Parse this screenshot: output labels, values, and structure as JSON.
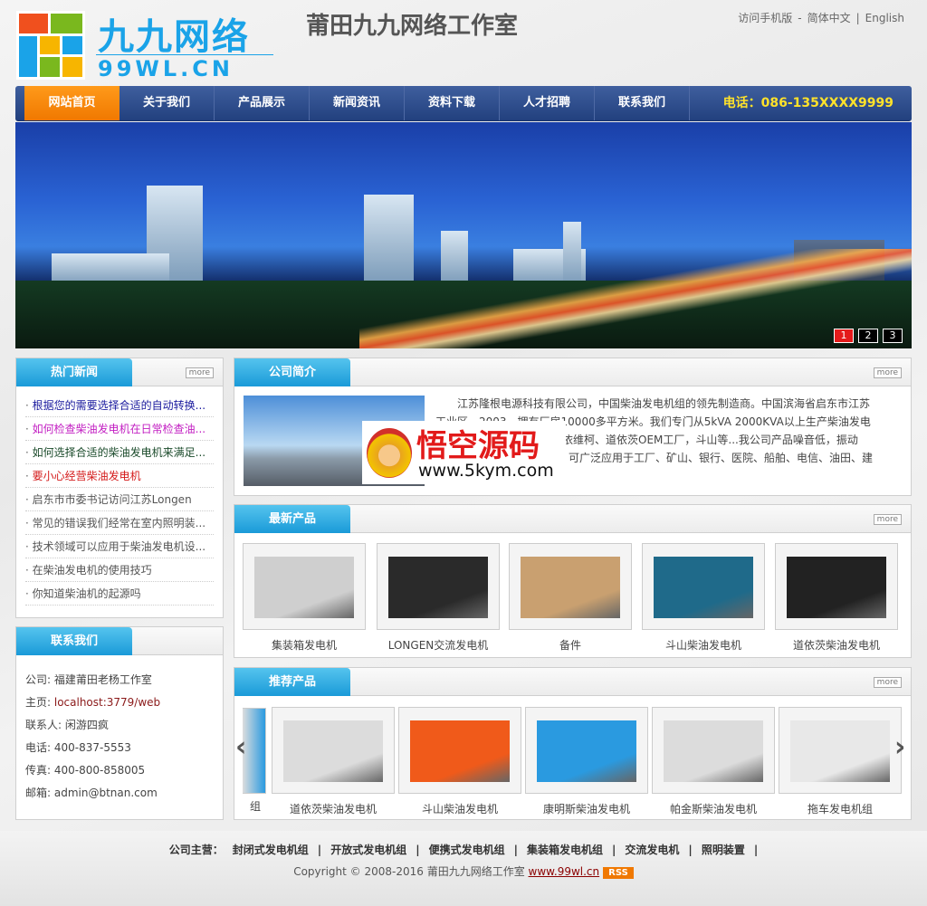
{
  "header": {
    "logo_cn": "九九网络",
    "logo_en": "99WL.CN",
    "site_title": "莆田九九网络工作室",
    "links": [
      "访问手机版",
      "简体中文",
      "English"
    ],
    "link_separators": [
      "-",
      "|"
    ]
  },
  "nav": {
    "items": [
      "网站首页",
      "关于我们",
      "产品展示",
      "新闻资讯",
      "资料下载",
      "人才招聘",
      "联系我们"
    ],
    "active": 0,
    "phone": "电话：086-135XXXX9999"
  },
  "banner": {
    "pages": [
      "1",
      "2",
      "3"
    ],
    "active": 0
  },
  "hot_news": {
    "title": "热门新闻",
    "more": "more",
    "items": [
      {
        "text": "根据您的需要选择合适的自动转换...",
        "color": "#1a1a9e"
      },
      {
        "text": "如何检查柴油发电机在日常检查油...",
        "color": "#c21ec2"
      },
      {
        "text": "如何选择合适的柴油发电机来满足...",
        "color": "#1a4a2a"
      },
      {
        "text": "要小心经营柴油发电机",
        "color": "#d41a1a"
      },
      {
        "text": "启东市市委书记访问江苏Longen",
        "color": "#555555"
      },
      {
        "text": "常见的错误我们经常在室内照明装...",
        "color": "#555555"
      },
      {
        "text": "技术领域可以应用于柴油发电机设...",
        "color": "#555555"
      },
      {
        "text": "在柴油发电机的使用技巧",
        "color": "#555555"
      },
      {
        "text": "你知道柴油机的起源吗",
        "color": "#555555"
      }
    ]
  },
  "contact": {
    "title": "联系我们",
    "rows": [
      {
        "label": "公司: ",
        "value": "福建莆田老杨工作室"
      },
      {
        "label": "主页: ",
        "value": "localhost:3779/web"
      },
      {
        "label": "联系人: ",
        "value": "闲游四疯"
      },
      {
        "label": "电话: ",
        "value": "400-837-5553"
      },
      {
        "label": "传真: ",
        "value": "400-800-858005"
      },
      {
        "label": "邮箱: ",
        "value": "admin@btnan.com"
      }
    ]
  },
  "intro": {
    "title": "公司简介",
    "more": "more",
    "lines": [
      "江苏隆根电源科技有限公司，中国柴油发电机组的领先制造商。中国滨海省启东市江苏",
      "工业区，2003，拥有厂房10000多平方米。我们专门从5kVA 2000KVA以上生产柴油发电",
      "依维柯、道依茨OEM工厂，斗山等...我公司产品噪音低，振动",
      "，可广泛应用于工厂、矿山、银行、医院、船舶、电信、油田、建"
    ]
  },
  "watermark": {
    "title": "悟空源码",
    "url": "www.5kym.com"
  },
  "new_products": {
    "title": "最新产品",
    "more": "more",
    "items": [
      {
        "name": "集装箱发电机",
        "color": "#cfcfcf"
      },
      {
        "name": "LONGEN交流发电机",
        "color": "#2a2a2a"
      },
      {
        "name": "备件",
        "color": "#c9a070"
      },
      {
        "name": "斗山柴油发电机",
        "color": "#1f6a8a"
      },
      {
        "name": "道依茨柴油发电机",
        "color": "#222222"
      }
    ]
  },
  "recommended": {
    "title": "推荐产品",
    "more": "more",
    "partial_left": "组",
    "items": [
      {
        "name": "道依茨柴油发电机",
        "color": "#dcdcdc"
      },
      {
        "name": "斗山柴油发电机",
        "color": "#f05a1a"
      },
      {
        "name": "康明斯柴油发电机",
        "color": "#2a9ae0"
      },
      {
        "name": "帕金斯柴油发电机",
        "color": "#dcdcdc"
      },
      {
        "name": "拖车发电机组",
        "color": "#e8e8e8"
      }
    ]
  },
  "footer": {
    "label": "公司主营：",
    "links": [
      "封闭式发电机组",
      "开放式发电机组",
      "便携式发电机组",
      "集装箱发电机组",
      "交流发电机",
      "照明装置"
    ],
    "separator": "|",
    "copyright": "Copyright © 2008-2016 莆田九九网络工作室",
    "site_link": "www.99wl.cn",
    "rss": "RSS"
  }
}
